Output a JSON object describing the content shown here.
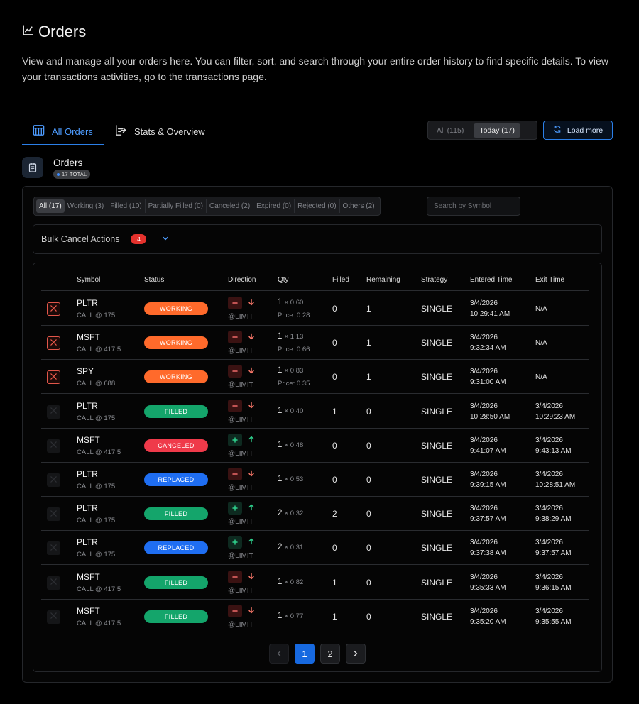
{
  "header": {
    "title": "Orders",
    "description": "View and manage all your orders here. You can filter, sort, and search through your entire order history to find specific details. To view your transactions activities, go to the transactions page."
  },
  "tabs": [
    {
      "label": "All Orders",
      "icon": "building-icon",
      "active": true
    },
    {
      "label": "Stats & Overview",
      "icon": "export-icon",
      "active": false
    }
  ],
  "range_toggle": {
    "all": "All (115)",
    "today": "Today (17)",
    "selected": "today"
  },
  "load_more": "Load more",
  "orders_card": {
    "title": "Orders",
    "total_badge": "17 TOTAL"
  },
  "filters": [
    {
      "label": "All (17)",
      "selected": true
    },
    {
      "label": "Working (3)"
    },
    {
      "label": "Filled (10)"
    },
    {
      "label": "Partially Filled (0)"
    },
    {
      "label": "Canceled (2)"
    },
    {
      "label": "Expired (0)"
    },
    {
      "label": "Rejected (0)"
    },
    {
      "label": "Others (2)"
    }
  ],
  "search": {
    "placeholder": "Search by Symbol",
    "value": ""
  },
  "bulk": {
    "label": "Bulk Cancel Actions",
    "count": "4"
  },
  "columns": {
    "symbol": "Symbol",
    "status": "Status",
    "direction": "Direction",
    "qty": "Qty",
    "filled": "Filled",
    "remaining": "Remaining",
    "strategy": "Strategy",
    "entered": "Entered Time",
    "exit": "Exit Time"
  },
  "status_colors": {
    "WORKING": "#ff6a2b",
    "FILLED": "#14a56b",
    "CANCELED": "#ef3a4a",
    "REPLACED": "#1f6ef2"
  },
  "rows": [
    {
      "cancellable": true,
      "symbol": "PLTR",
      "contract": "CALL @ 175",
      "status": "WORKING",
      "side": "sell",
      "order_type": "@LIMIT",
      "qty": "1",
      "qty_price": "× 0.60",
      "price": "Price: 0.28",
      "filled": "0",
      "remaining": "1",
      "strategy": "SINGLE",
      "entered_date": "3/4/2026",
      "entered_time": "10:29:41 AM",
      "exit_date": "N/A",
      "exit_time": ""
    },
    {
      "cancellable": true,
      "symbol": "MSFT",
      "contract": "CALL @ 417.5",
      "status": "WORKING",
      "side": "sell",
      "order_type": "@LIMIT",
      "qty": "1",
      "qty_price": "× 1.13",
      "price": "Price: 0.66",
      "filled": "0",
      "remaining": "1",
      "strategy": "SINGLE",
      "entered_date": "3/4/2026",
      "entered_time": "9:32:34 AM",
      "exit_date": "N/A",
      "exit_time": ""
    },
    {
      "cancellable": true,
      "symbol": "SPY",
      "contract": "CALL @ 688",
      "status": "WORKING",
      "side": "sell",
      "order_type": "@LIMIT",
      "qty": "1",
      "qty_price": "× 0.83",
      "price": "Price: 0.35",
      "filled": "0",
      "remaining": "1",
      "strategy": "SINGLE",
      "entered_date": "3/4/2026",
      "entered_time": "9:31:00 AM",
      "exit_date": "N/A",
      "exit_time": ""
    },
    {
      "cancellable": false,
      "symbol": "PLTR",
      "contract": "CALL @ 175",
      "status": "FILLED",
      "side": "sell",
      "order_type": "@LIMIT",
      "qty": "1",
      "qty_price": "× 0.40",
      "price": "",
      "filled": "1",
      "remaining": "0",
      "strategy": "SINGLE",
      "entered_date": "3/4/2026",
      "entered_time": "10:28:50 AM",
      "exit_date": "3/4/2026",
      "exit_time": "10:29:23 AM"
    },
    {
      "cancellable": false,
      "symbol": "MSFT",
      "contract": "CALL @ 417.5",
      "status": "CANCELED",
      "side": "buy",
      "order_type": "@LIMIT",
      "qty": "1",
      "qty_price": "× 0.48",
      "price": "",
      "filled": "0",
      "remaining": "0",
      "strategy": "SINGLE",
      "entered_date": "3/4/2026",
      "entered_time": "9:41:07 AM",
      "exit_date": "3/4/2026",
      "exit_time": "9:43:13 AM"
    },
    {
      "cancellable": false,
      "symbol": "PLTR",
      "contract": "CALL @ 175",
      "status": "REPLACED",
      "side": "sell",
      "order_type": "@LIMIT",
      "qty": "1",
      "qty_price": "× 0.53",
      "price": "",
      "filled": "0",
      "remaining": "0",
      "strategy": "SINGLE",
      "entered_date": "3/4/2026",
      "entered_time": "9:39:15 AM",
      "exit_date": "3/4/2026",
      "exit_time": "10:28:51 AM"
    },
    {
      "cancellable": false,
      "symbol": "PLTR",
      "contract": "CALL @ 175",
      "status": "FILLED",
      "side": "buy",
      "order_type": "@LIMIT",
      "qty": "2",
      "qty_price": "× 0.32",
      "price": "",
      "filled": "2",
      "remaining": "0",
      "strategy": "SINGLE",
      "entered_date": "3/4/2026",
      "entered_time": "9:37:57 AM",
      "exit_date": "3/4/2026",
      "exit_time": "9:38:29 AM"
    },
    {
      "cancellable": false,
      "symbol": "PLTR",
      "contract": "CALL @ 175",
      "status": "REPLACED",
      "side": "buy",
      "order_type": "@LIMIT",
      "qty": "2",
      "qty_price": "× 0.31",
      "price": "",
      "filled": "0",
      "remaining": "0",
      "strategy": "SINGLE",
      "entered_date": "3/4/2026",
      "entered_time": "9:37:38 AM",
      "exit_date": "3/4/2026",
      "exit_time": "9:37:57 AM"
    },
    {
      "cancellable": false,
      "symbol": "MSFT",
      "contract": "CALL @ 417.5",
      "status": "FILLED",
      "side": "sell",
      "order_type": "@LIMIT",
      "qty": "1",
      "qty_price": "× 0.82",
      "price": "",
      "filled": "1",
      "remaining": "0",
      "strategy": "SINGLE",
      "entered_date": "3/4/2026",
      "entered_time": "9:35:33 AM",
      "exit_date": "3/4/2026",
      "exit_time": "9:36:15 AM"
    },
    {
      "cancellable": false,
      "symbol": "MSFT",
      "contract": "CALL @ 417.5",
      "status": "FILLED",
      "side": "sell",
      "order_type": "@LIMIT",
      "qty": "1",
      "qty_price": "× 0.77",
      "price": "",
      "filled": "1",
      "remaining": "0",
      "strategy": "SINGLE",
      "entered_date": "3/4/2026",
      "entered_time": "9:35:20 AM",
      "exit_date": "3/4/2026",
      "exit_time": "9:35:55 AM"
    }
  ],
  "pagination": {
    "pages": [
      "1",
      "2"
    ],
    "current": "1"
  }
}
